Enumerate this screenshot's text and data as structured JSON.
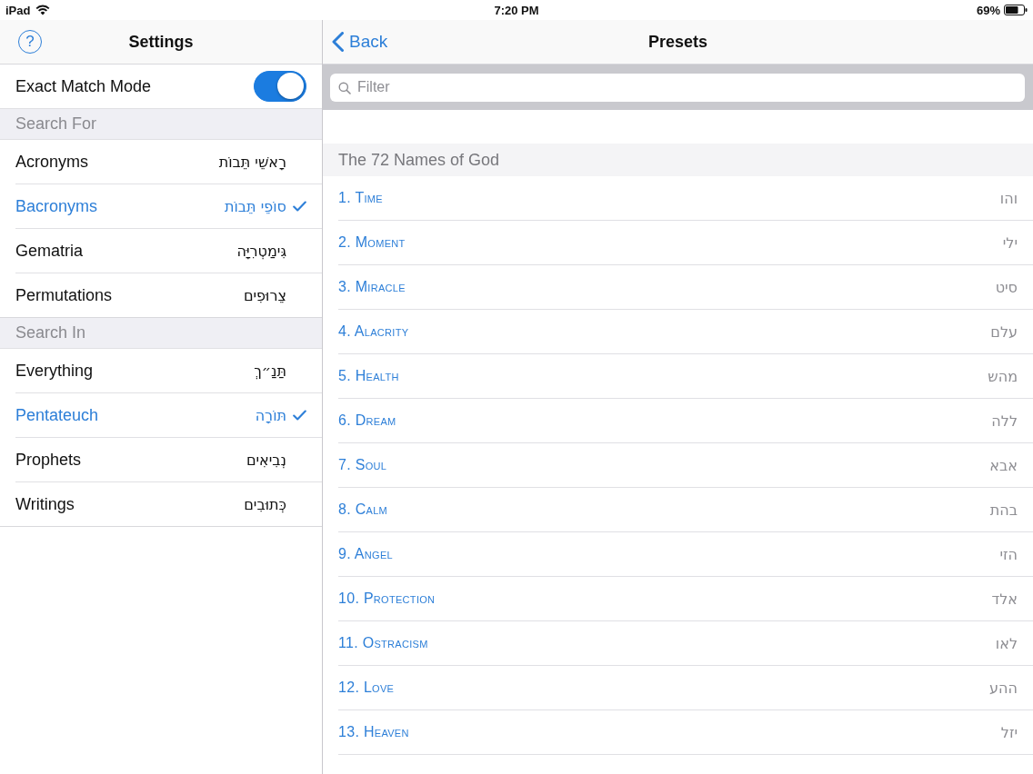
{
  "status_bar": {
    "device": "iPad",
    "time": "7:20 PM",
    "battery": "69%"
  },
  "settings": {
    "title": "Settings",
    "help_symbol": "?",
    "exact_match": {
      "label": "Exact Match Mode",
      "on": true
    },
    "sections": [
      {
        "header": "Search For",
        "items": [
          {
            "label": "Acronyms",
            "hebrew": "רָאשֵׁי תֵּבוֹת",
            "selected": false
          },
          {
            "label": "Bacronyms",
            "hebrew": "סוֹפֵי תֵּבוֹת",
            "selected": true
          },
          {
            "label": "Gematria",
            "hebrew": "גִּימַטְרִיָּה",
            "selected": false
          },
          {
            "label": "Permutations",
            "hebrew": "צֵרוּפִים",
            "selected": false
          }
        ]
      },
      {
        "header": "Search In",
        "items": [
          {
            "label": "Everything",
            "hebrew": "תַּנַ״ךְ",
            "selected": false
          },
          {
            "label": "Pentateuch",
            "hebrew": "תּוֹרָה",
            "selected": true
          },
          {
            "label": "Prophets",
            "hebrew": "נְבִיאִים",
            "selected": false
          },
          {
            "label": "Writings",
            "hebrew": "כְּתוּבִים",
            "selected": false
          }
        ]
      }
    ]
  },
  "presets": {
    "back": "Back",
    "title": "Presets",
    "filter": {
      "placeholder": "Filter"
    },
    "group": {
      "header": "The 72 Names of God",
      "items": [
        {
          "label": "1. Time",
          "hebrew": "והו"
        },
        {
          "label": "2. Moment",
          "hebrew": "ילי"
        },
        {
          "label": "3. Miracle",
          "hebrew": "סיט"
        },
        {
          "label": "4. Alacrity",
          "hebrew": "עלם"
        },
        {
          "label": "5. Health",
          "hebrew": "מהש"
        },
        {
          "label": "6. Dream",
          "hebrew": "ללה"
        },
        {
          "label": "7. Soul",
          "hebrew": "אבא"
        },
        {
          "label": "8. Calm",
          "hebrew": "בהת"
        },
        {
          "label": "9. Angel",
          "hebrew": "הזי"
        },
        {
          "label": "10. Protection",
          "hebrew": "אלד"
        },
        {
          "label": "11. Ostracism",
          "hebrew": "לאו"
        },
        {
          "label": "12. Love",
          "hebrew": "ההע"
        },
        {
          "label": "13. Heaven",
          "hebrew": "יזל"
        }
      ]
    }
  }
}
